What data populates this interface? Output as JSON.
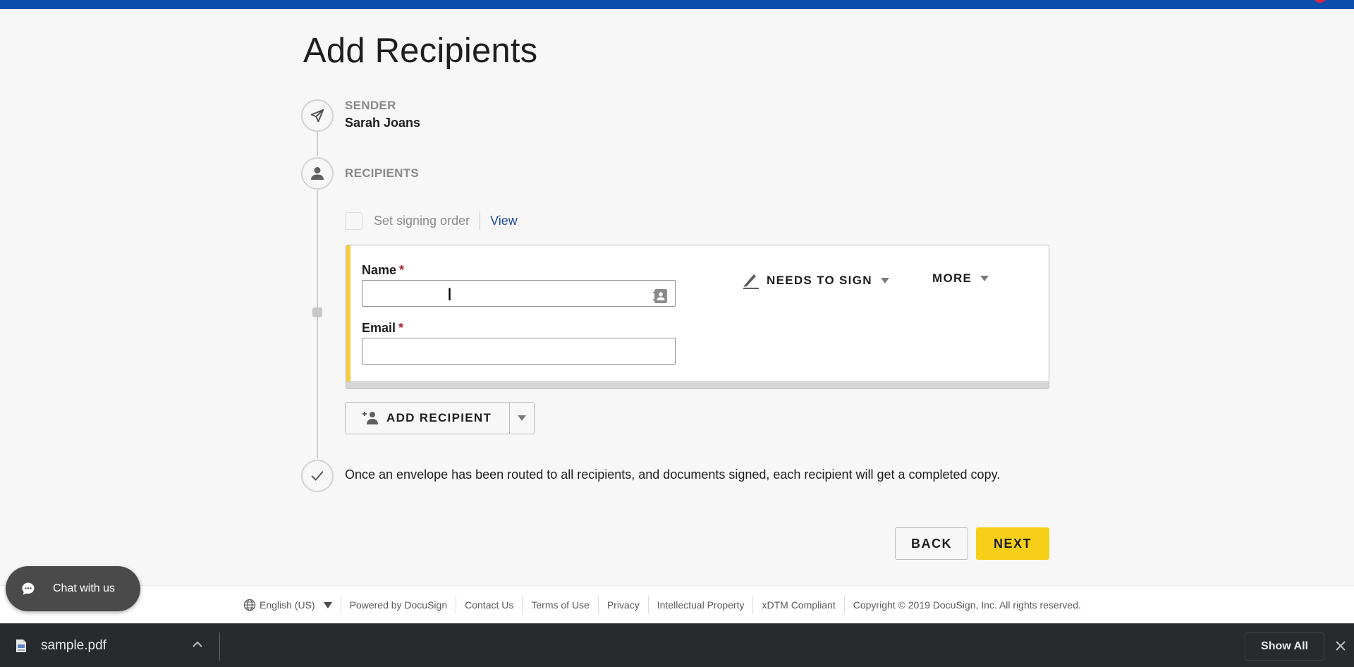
{
  "page": {
    "title": "Add Recipients"
  },
  "colors": {
    "brand_blue": "#0a4fad",
    "accent_yellow": "#f7cf18",
    "card_accent": "#f6ce3d",
    "link_blue": "#1f4fa0",
    "required_red": "#b0223a"
  },
  "steps": {
    "sender": {
      "label": "SENDER",
      "name": "Sarah Joans",
      "icon": "paper-plane-icon"
    },
    "recipients": {
      "label": "RECIPIENTS",
      "icon": "person-icon",
      "signing_order_label": "Set signing order",
      "signing_order_checked": false,
      "view_link": "View"
    },
    "completion": {
      "icon": "checkmark-icon",
      "text": "Once an envelope has been routed to all recipients, and documents signed, each recipient will get a completed copy."
    }
  },
  "recipient_card": {
    "name_label": "Name",
    "name_value": "",
    "email_label": "Email",
    "email_value": "",
    "required_mark": "*",
    "action_label": "NEEDS TO SIGN",
    "more_label": "MORE"
  },
  "add_recipient": {
    "label": "ADD RECIPIENT"
  },
  "navigation": {
    "back_label": "BACK",
    "next_label": "NEXT"
  },
  "chat": {
    "label": "Chat with us"
  },
  "footer": {
    "language": "English (US)",
    "links": [
      "Powered by DocuSign",
      "Contact Us",
      "Terms of Use",
      "Privacy",
      "Intellectual Property",
      "xDTM Compliant"
    ],
    "copyright": "Copyright © 2019 DocuSign, Inc. All rights reserved."
  },
  "download_bar": {
    "file_name": "sample.pdf",
    "show_all_label": "Show All"
  }
}
